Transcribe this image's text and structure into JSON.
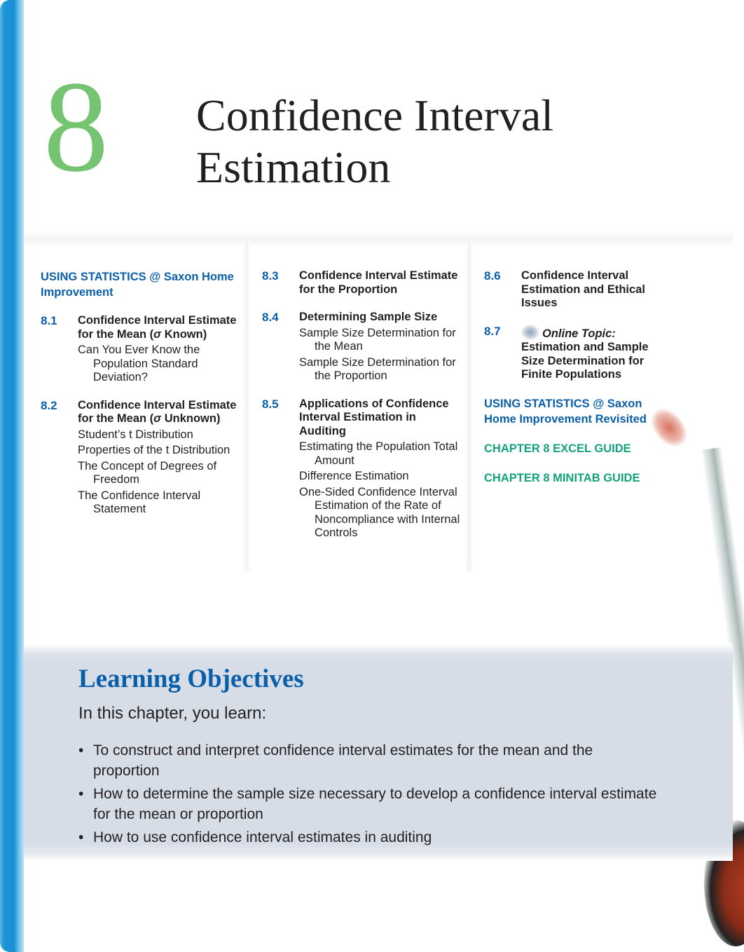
{
  "chapter": {
    "number": "8",
    "title_line1": "Confidence Interval",
    "title_line2": "Estimation"
  },
  "toc": {
    "col1": {
      "using_stats": "USING STATISTICS @ Saxon Home Improvement",
      "entries": [
        {
          "num": "8.1",
          "title_pre": "Confidence Interval Estimate for the Mean (",
          "sigma": "σ",
          "title_post": " Known)",
          "subs": [
            "Can You Ever Know the Population Standard Deviation?"
          ]
        },
        {
          "num": "8.2",
          "title_pre": "Confidence Interval Estimate for the Mean (",
          "sigma": "σ",
          "title_post": " Unknown)",
          "subs": [
            "Student’s t Distribution",
            "Properties of the t Distribution",
            "The Concept of Degrees of Freedom",
            "The Confidence Interval Statement"
          ]
        }
      ]
    },
    "col2": {
      "entries": [
        {
          "num": "8.3",
          "title": "Confidence Interval Estimate for the Proportion",
          "subs": []
        },
        {
          "num": "8.4",
          "title": "Determining Sample Size",
          "subs": [
            "Sample Size Determination for the Mean",
            "Sample Size Determination for the Proportion"
          ]
        },
        {
          "num": "8.5",
          "title": "Applications of Confidence Interval Estimation in Auditing",
          "subs": [
            "Estimating the Population Total Amount",
            "Difference Estimation",
            "One-Sided Confidence Interval Estimation of the Rate of Noncompliance with Internal Controls"
          ]
        }
      ]
    },
    "col3": {
      "entries": [
        {
          "num": "8.6",
          "title": "Confidence Interval Estimation and Ethical Issues"
        },
        {
          "num": "8.7",
          "online_label": "Online Topic:",
          "title": "Estimation and Sample Size Determination for Finite Populations"
        }
      ],
      "using_stats_revisited": "USING STATISTICS @ Saxon Home Improvement Revisited",
      "excel_guide": "CHAPTER 8 EXCEL GUIDE",
      "minitab_guide": "CHAPTER 8 MINITAB GUIDE"
    }
  },
  "learning_objectives": {
    "title": "Learning Objectives",
    "intro": "In this chapter, you learn:",
    "bullet_glyph": "•",
    "items": [
      "To construct and interpret confidence interval estimates for the mean and the proportion",
      "How to determine the sample size necessary to develop a confidence interval estimate for the mean or proportion",
      "How to use confidence interval estimates in auditing"
    ]
  },
  "colors": {
    "chapter_number": "#75c471",
    "accent_blue": "#0a5fa8",
    "guide_green": "#13a37c",
    "band_gray": "#d7dde7",
    "side_bar": "#1a96d8"
  }
}
